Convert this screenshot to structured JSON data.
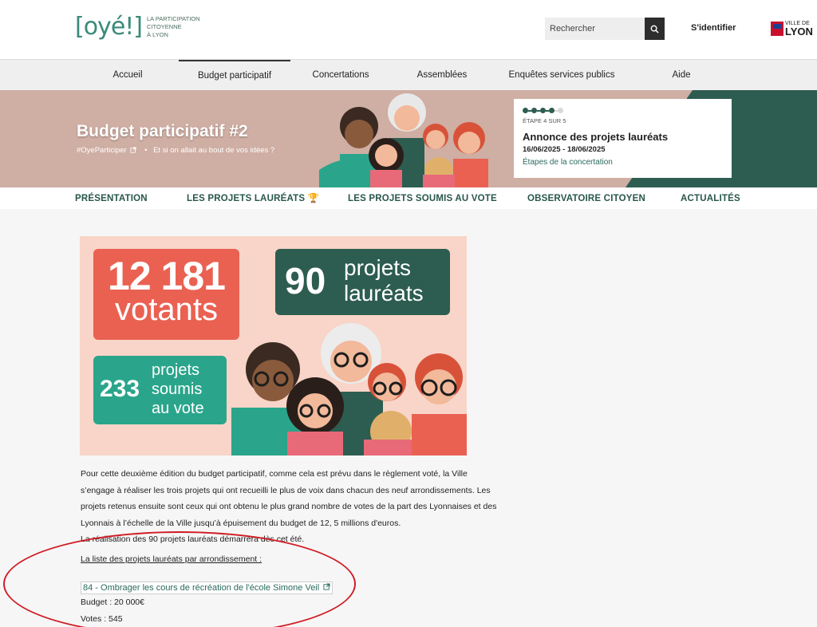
{
  "header": {
    "logo_mark": "[oyé!]",
    "logo_line1": "LA PARTICIPATION",
    "logo_line2": "CITOYENNE",
    "logo_line3": "À LYON",
    "search_placeholder": "Rechercher",
    "signin_label": "S'identifier",
    "city_small": "VILLE DE",
    "city_big": "LYON"
  },
  "main_nav": [
    {
      "label": "Accueil"
    },
    {
      "label": "Budget participatif"
    },
    {
      "label": "Concertations"
    },
    {
      "label": "Assemblées"
    },
    {
      "label": "Enquêtes services publics"
    },
    {
      "label": "Aide"
    }
  ],
  "banner": {
    "title": "Budget participatif #2",
    "hashtag": "#OyeParticiper",
    "separator": "•",
    "tagline": "Et si on allait au bout de vos idées ?"
  },
  "stage": {
    "step": "ÉTAPE 4 SUR 5",
    "name": "Annonce des projets lauréats",
    "dates": "16/06/2025 - 18/06/2025",
    "link": "Étapes de la concertation",
    "steps_total": 5,
    "steps_done": 4
  },
  "sub_nav": [
    {
      "label": "PRÉSENTATION"
    },
    {
      "label": "LES PROJETS LAURÉATS 🏆"
    },
    {
      "label": "LES PROJETS SOUMIS AU VOTE"
    },
    {
      "label": "OBSERVATOIRE CITOYEN"
    },
    {
      "label": "ACTUALITÉS"
    }
  ],
  "infographic": {
    "votants_num": "12 181",
    "votants_lbl": "votants",
    "laureats_num": "90",
    "laureats_lbl1": "projets",
    "laureats_lbl2": "lauréats",
    "soumis_num": "233",
    "soumis_lbl1": "projets",
    "soumis_lbl2": "soumis",
    "soumis_lbl3": "au vote"
  },
  "content": {
    "para_line1": "Pour cette deuxième édition du budget participatif, comme cela est prévu dans le règlement voté, la Ville",
    "para_line2": "s’engage à réaliser les trois projets qui ont recueilli le plus de voix dans chacun des neuf arrondissements. Les",
    "para_line3": "projets retenus ensuite sont ceux qui ont obtenu le plus grand nombre de votes de la part des Lyonnaises et des",
    "para_line4": "Lyonnais à l’échelle de la Ville jusqu’à épuisement du budget de 12, 5 millions d'euros.",
    "para_line5": "La réalisation des 90 projets lauréats démarrera dès cet été.",
    "list_title": "La liste des projets lauréats par arrondissement :",
    "project_link": "84 - Ombrager les cours de récréation de l'école Simone Veil",
    "budget": "Budget : 20 000€",
    "votes": "Votes : 545"
  }
}
